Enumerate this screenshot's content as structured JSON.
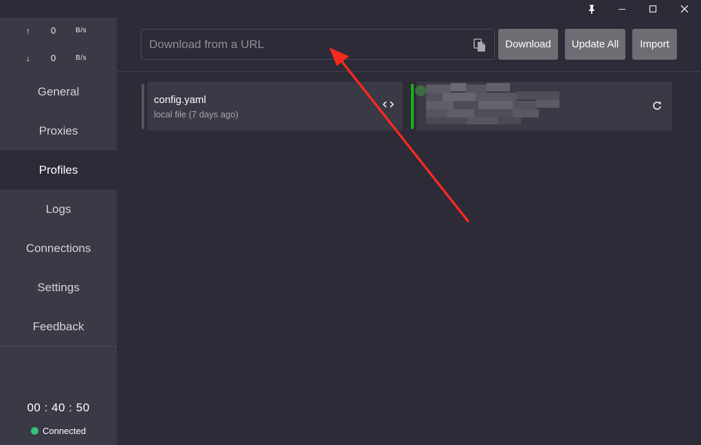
{
  "window": {
    "pin_icon": "pin-icon",
    "minimize_icon": "minimize-icon",
    "maximize_icon": "maximize-icon",
    "close_icon": "close-icon"
  },
  "traffic": {
    "upload": {
      "arrow": "↑",
      "value": "0",
      "unit": "B/s"
    },
    "download": {
      "arrow": "↓",
      "value": "0",
      "unit": "B/s"
    }
  },
  "nav": {
    "items": [
      {
        "label": "General"
      },
      {
        "label": "Proxies"
      },
      {
        "label": "Profiles",
        "active": true
      },
      {
        "label": "Logs"
      },
      {
        "label": "Connections"
      },
      {
        "label": "Settings"
      },
      {
        "label": "Feedback"
      }
    ]
  },
  "footer": {
    "uptime": "00 : 40 : 50",
    "status": "Connected",
    "status_color": "#35c17a"
  },
  "toolbar": {
    "url_placeholder": "Download from a URL",
    "url_value": "",
    "download_label": "Download",
    "update_all_label": "Update All",
    "import_label": "Import"
  },
  "profiles": [
    {
      "name": "config.yaml",
      "detail": "local file (7 days ago)",
      "action_icon": "code-icon",
      "bar_color": "#55545f"
    },
    {
      "name": "",
      "detail": "",
      "action_icon": "refresh-icon",
      "bar_color": "#19b21a",
      "obscured": true
    }
  ],
  "colors": {
    "background": "#2c2b37",
    "sidebar": "#3a3946",
    "button": "#6e6d74",
    "annotation_arrow": "#f42a1e"
  }
}
